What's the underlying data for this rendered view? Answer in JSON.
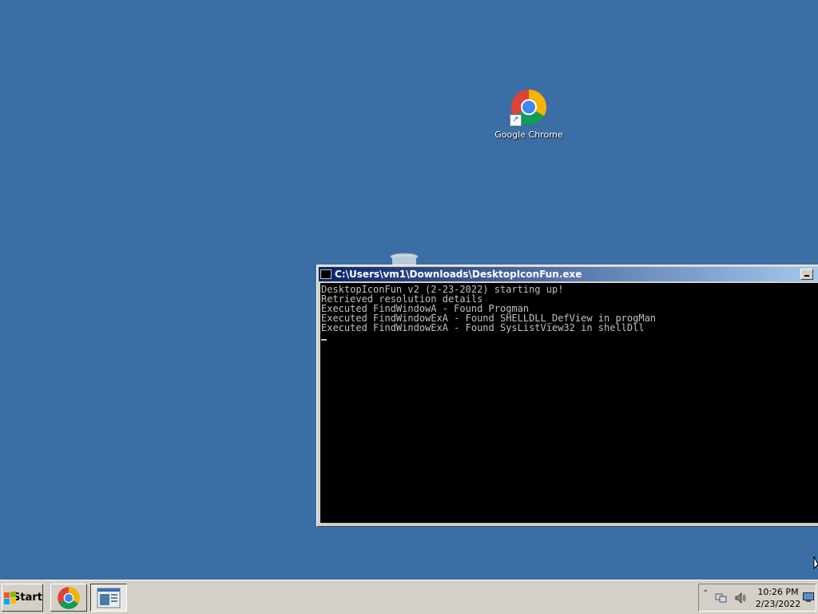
{
  "desktop": {
    "background": "#3a6ea5",
    "icons": [
      {
        "label": "Google Chrome",
        "icon": "chrome-icon"
      },
      {
        "label": "",
        "icon": "recycle-bin-icon"
      }
    ]
  },
  "console_window": {
    "title": "C:\\Users\\vm1\\Downloads\\DesktopIconFun.exe",
    "lines": [
      "DesktopIconFun v2 (2-23-2022) starting up!",
      "Retrieved resolution details",
      "Executed FindWindowA - Found Progman",
      "Executed FindWindowExA - Found SHELLDLL_DefView in progMan",
      "Executed FindWindowExA - Found SysListView32 in shellDll"
    ],
    "minimize_icon": "minimize-icon"
  },
  "taskbar": {
    "start_label": "Start",
    "buttons": [
      {
        "icon": "chrome-icon",
        "active": false
      },
      {
        "icon": "console-app-icon",
        "active": true
      }
    ],
    "tray": {
      "icons": [
        "show-hidden-icons-chevron",
        "network-icon",
        "volume-icon",
        "show-desktop-icon"
      ],
      "time": "10:26 PM",
      "date": "2/23/2022"
    }
  }
}
